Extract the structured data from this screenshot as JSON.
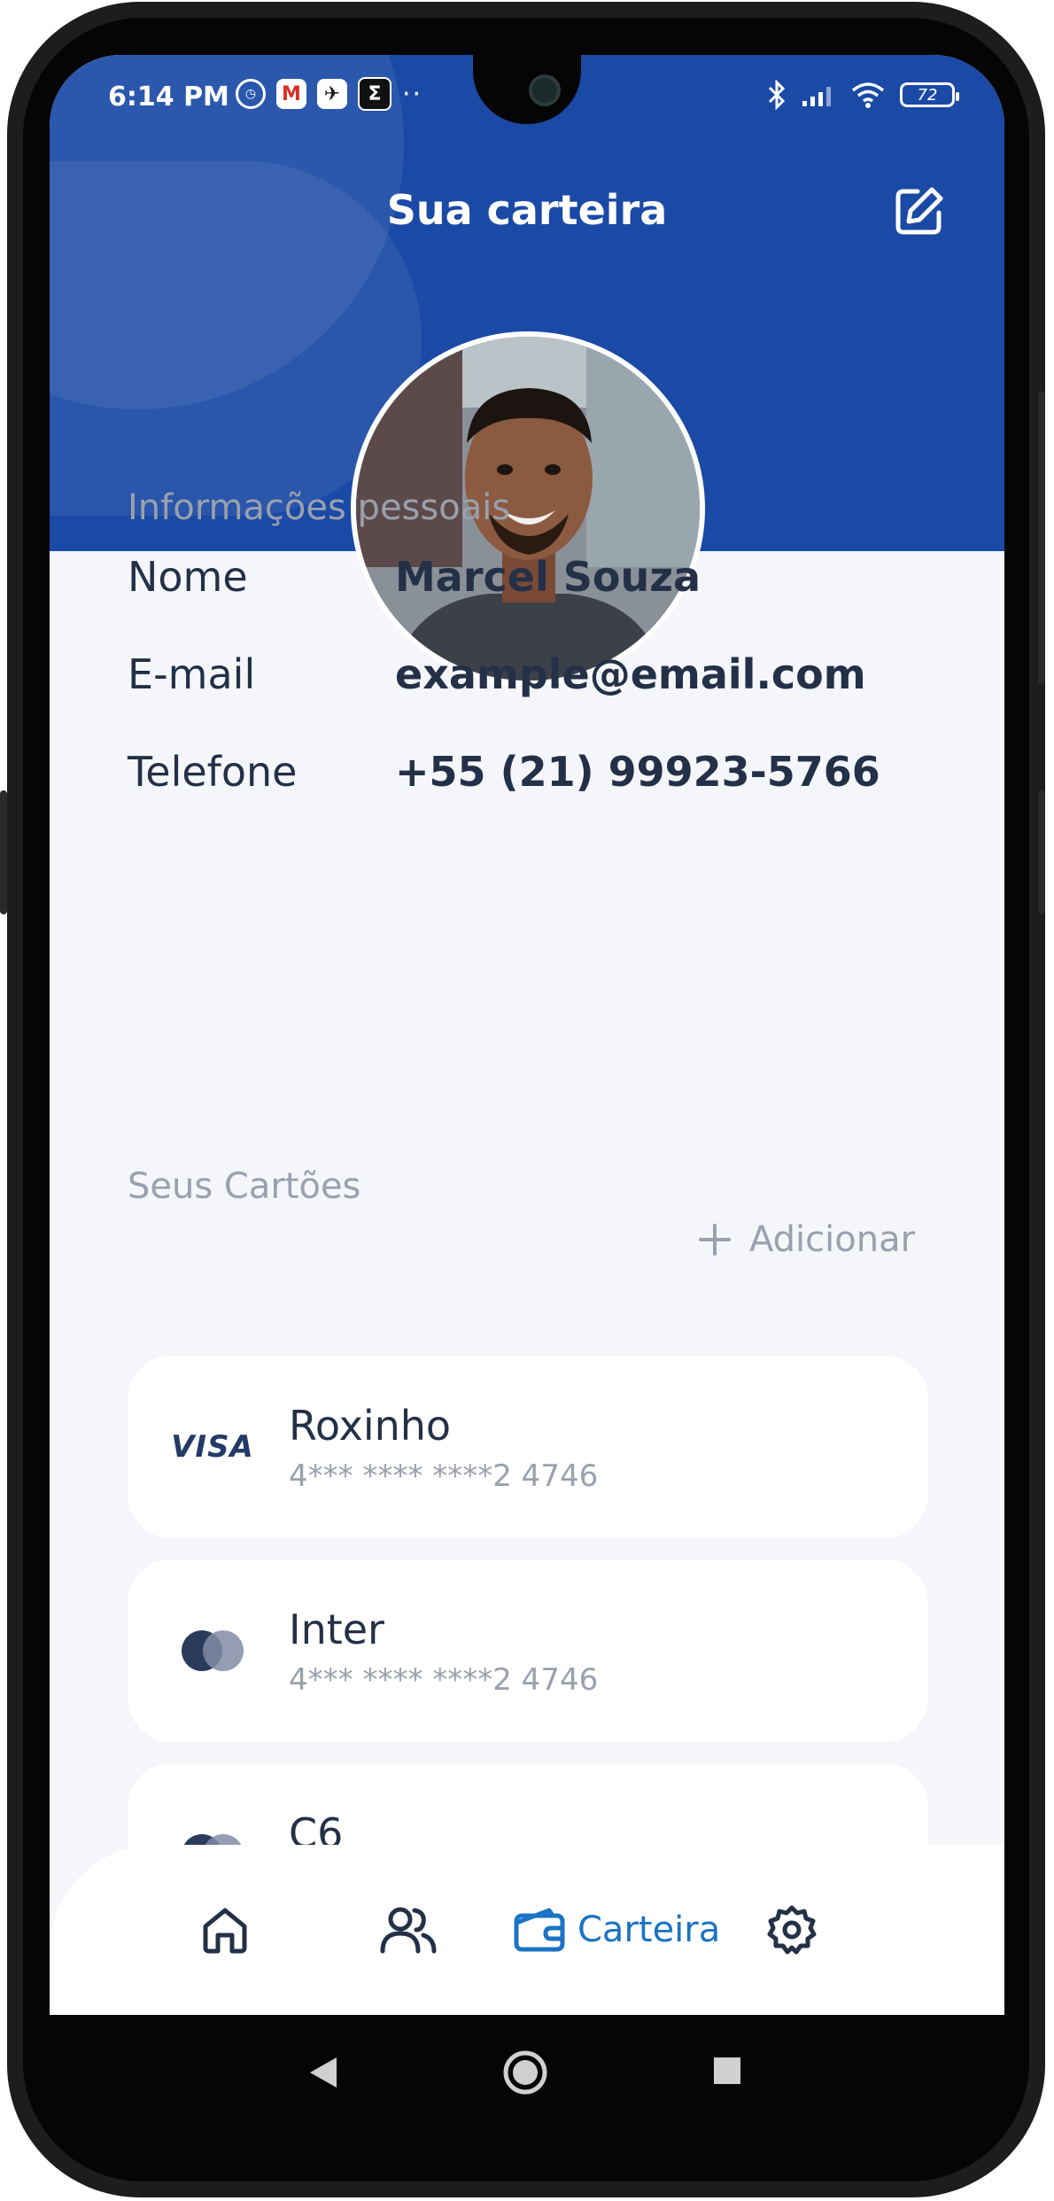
{
  "status_bar": {
    "time": "6:14 PM",
    "battery": "72",
    "icons_left": [
      "alarm-icon",
      "gmail-icon",
      "app-icon",
      "sigma-icon",
      "more-dots-icon"
    ],
    "icons_right": [
      "bluetooth-icon",
      "signal-icon",
      "wifi-icon",
      "battery-icon"
    ]
  },
  "header": {
    "title": "Sua carteira",
    "edit_icon": "edit-icon",
    "accent_color": "#1a4aa6"
  },
  "personal_info": {
    "section_title": "Informações pessoais",
    "fields": [
      {
        "label": "Nome",
        "value": "Marcel Souza"
      },
      {
        "label": "E-mail",
        "value": "example@email.com"
      },
      {
        "label": "Telefone",
        "value": "+55 (21) 99923-5766"
      }
    ]
  },
  "cards_section": {
    "title": "Seus Cartões",
    "add_label": "Adicionar",
    "cards": [
      {
        "brand": "visa",
        "brand_label": "VISA",
        "name": "Roxinho",
        "number": "4*** **** ****2 4746"
      },
      {
        "brand": "mastercard",
        "name": "Inter",
        "number": "4*** **** ****2 4746"
      },
      {
        "brand": "mastercard",
        "name": "C6",
        "number": ""
      }
    ]
  },
  "bottom_nav": {
    "items": [
      {
        "icon": "home-icon",
        "label": ""
      },
      {
        "icon": "users-icon",
        "label": ""
      },
      {
        "icon": "wallet-icon",
        "label": "Carteira",
        "active": true
      },
      {
        "icon": "settings-icon",
        "label": ""
      }
    ],
    "active_color": "#1b73c4"
  }
}
